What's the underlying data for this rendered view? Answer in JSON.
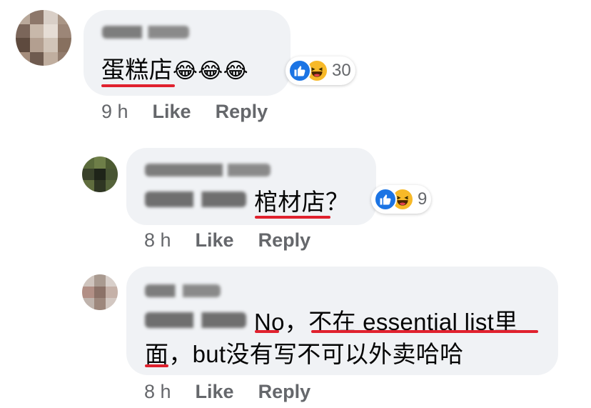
{
  "comments": [
    {
      "text_main": "蛋糕店",
      "text_emoji": "😂😂😂",
      "reaction_count": "30",
      "time": "9 h",
      "like_label": "Like",
      "reply_label": "Reply"
    },
    {
      "text_main": "棺材店",
      "text_after": "？",
      "reaction_count": "9",
      "time": "8 h",
      "like_label": "Like",
      "reply_label": "Reply"
    },
    {
      "line1_before": "No，",
      "line1_red": "不在 essential list里",
      "line2_red": "面",
      "line2_after": "，but没有写不可以外卖哈哈",
      "time": "8 h",
      "like_label": "Like",
      "reply_label": "Reply"
    }
  ],
  "icons": {
    "like": "thumbs-up-icon",
    "haha": "laughing-face-icon"
  },
  "colors": {
    "bubble": "#f0f2f5",
    "underline": "#e0212e",
    "like_blue": "#1b74e4",
    "haha_yellow": "#f7b928",
    "meta": "#65676b"
  }
}
